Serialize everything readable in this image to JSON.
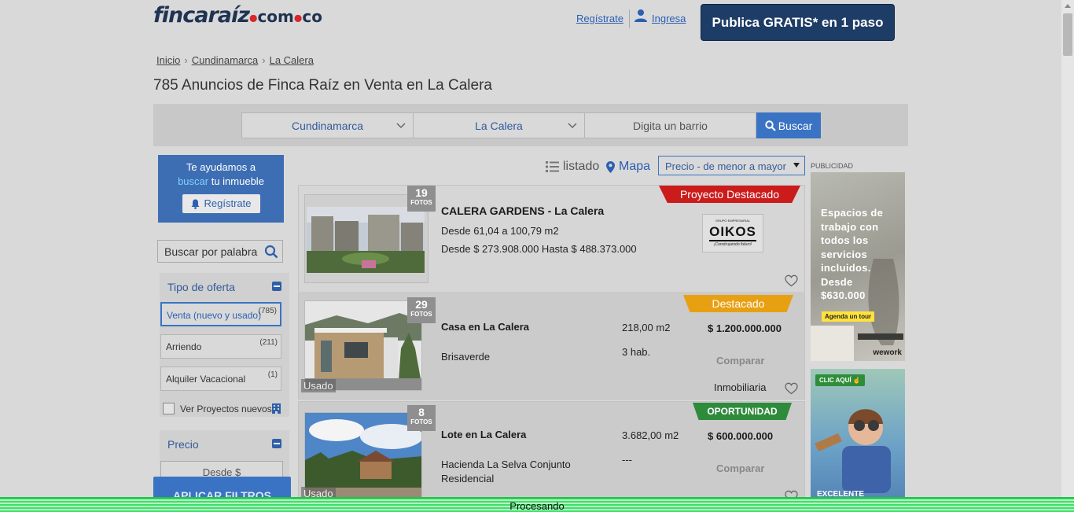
{
  "header": {
    "logo_main": "fincaraíz",
    "logo_com": "com",
    "logo_co": "co",
    "register_link": "Regístrate",
    "login_link": "Ingresa",
    "publish_button": "Publica GRATIS* en 1 paso"
  },
  "breadcrumb": [
    "Inicio",
    "Cundinamarca",
    "La Calera"
  ],
  "page_title": "785 Anuncios de Finca Raíz en Venta en La Calera",
  "search": {
    "department": "Cundinamarca",
    "city": "La Calera",
    "neighborhood_placeholder": "Digita un barrio",
    "search_button": "Buscar"
  },
  "sidebar": {
    "help_line1": "Te ayudamos a",
    "help_highlight": "buscar",
    "help_line2": "tu inmueble",
    "help_register": "Regístrate",
    "keyword_placeholder": "Buscar por palabra",
    "offer_type_title": "Tipo de oferta",
    "offer_options": [
      {
        "label": "Venta (nuevo y usado)",
        "count": "(785)"
      },
      {
        "label": "Arriendo",
        "count": "(211)"
      },
      {
        "label": "Alquiler Vacacional",
        "count": "(1)"
      }
    ],
    "projects_checkbox": "Ver Proyectos nuevos",
    "price_title": "Precio",
    "price_from_placeholder": "Desde $",
    "apply_button": "APLICAR FILTROS"
  },
  "view": {
    "list_label": "listado",
    "map_label": "Mapa",
    "sort_value": "Precio - de menor a mayor"
  },
  "listings": [
    {
      "photos": "19",
      "photos_label": "FOTOS",
      "badge": "Proyecto Destacado",
      "title": "CALERA GARDENS - La Calera",
      "area_range": "Desde 61,04 a 100,79 m2",
      "price_range": "Desde $ 273.908.000 Hasta $ 488.373.000",
      "developer_top": "GRUPO EMPRESARIAL",
      "developer": "OIKOS",
      "developer_tagline": "¡Construyendo futuro!"
    },
    {
      "photos": "29",
      "photos_label": "FOTOS",
      "badge": "Destacado",
      "condition": "Usado",
      "title": "Casa en La Calera",
      "area": "218,00 m2",
      "price": "$ 1.200.000.000",
      "rooms": "3 hab.",
      "location": "Brisaverde",
      "compare": "Comparar",
      "seller": "Inmobiliaria"
    },
    {
      "photos": "8",
      "photos_label": "FOTOS",
      "badge": "OPORTUNIDAD",
      "condition": "Usado",
      "title": "Lote en La Calera",
      "area": "3.682,00 m2",
      "price": "$ 600.000.000",
      "rooms": "---",
      "location": "Hacienda La Selva Conjunto Residencial",
      "compare": "Comparar"
    }
  ],
  "ads": {
    "label": "PUBLICIDAD",
    "ad1_text": "Espacios de trabajo con todos los servicios incluidos. Desde $630.000",
    "ad1_cta": "Agenda un tour",
    "ad1_brand": "wework",
    "ad2_cta": "CLIC AQUÍ",
    "ad2_text": "EXCELENTE UBICACIÓN"
  },
  "status_bar": "Procesando",
  "colors": {
    "brand_navy": "#1d3c66",
    "accent_blue": "#3a73c3",
    "badge_red": "#cc1b1b",
    "badge_orange": "#e8a013",
    "badge_green": "#2e8b3c",
    "status_green": "#3ee06a"
  }
}
